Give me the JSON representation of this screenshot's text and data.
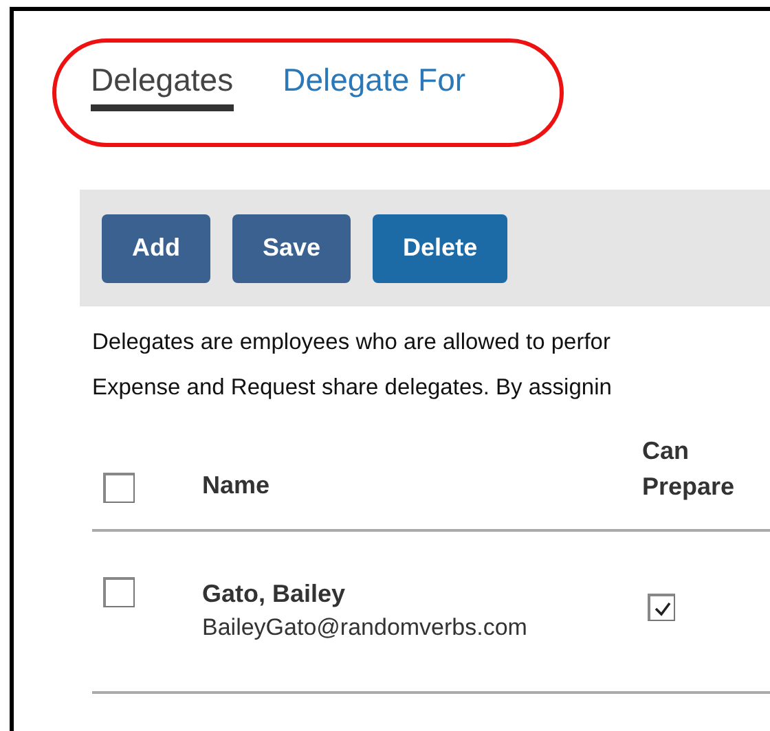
{
  "tabs": [
    {
      "label": "Delegates",
      "selected": true
    },
    {
      "label": "Delegate For",
      "selected": false
    }
  ],
  "annotation": {
    "kind": "oval"
  },
  "toolbar": {
    "buttons": [
      {
        "label": "Add",
        "color": "#3a6190"
      },
      {
        "label": "Save",
        "color": "#3a6190"
      },
      {
        "label": "Delete",
        "color": "#1c6aa6"
      }
    ]
  },
  "description": [
    "Delegates are employees who are allowed to perfor",
    "Expense and Request share delegates. By assignin"
  ],
  "table": {
    "header_checked": false,
    "columns": [
      "Name",
      "Can Prepare"
    ],
    "rows": [
      {
        "checked": false,
        "name": "Gato, Bailey",
        "email": "BaileyGato@randomverbs.com",
        "can_prepare": true
      }
    ]
  }
}
